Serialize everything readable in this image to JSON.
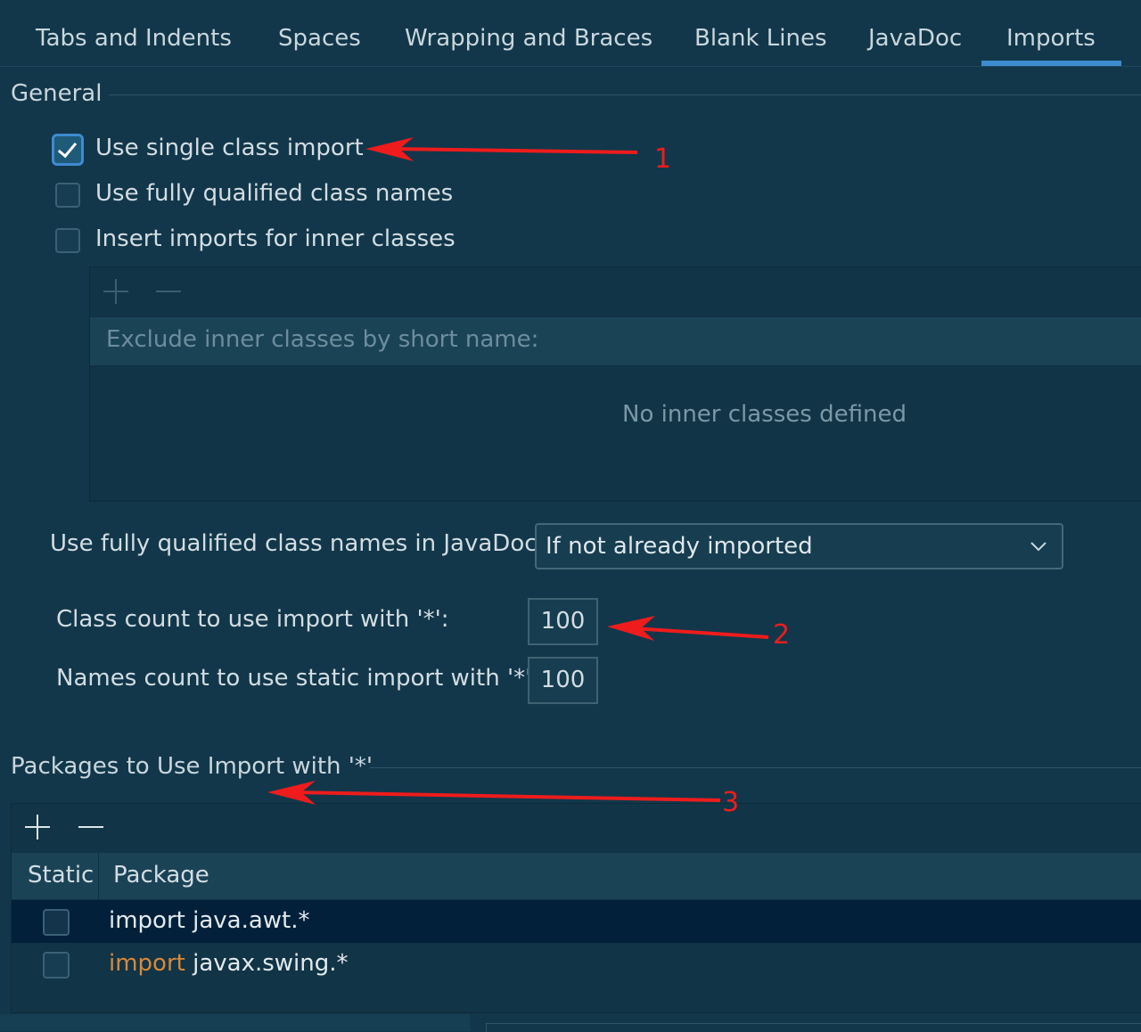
{
  "tabs": [
    {
      "label": "Tabs and Indents"
    },
    {
      "label": "Spaces"
    },
    {
      "label": "Wrapping and Braces"
    },
    {
      "label": "Blank Lines"
    },
    {
      "label": "JavaDoc"
    },
    {
      "label": "Imports",
      "selected": true
    }
  ],
  "general": {
    "title": "General",
    "options": [
      {
        "label": "Use single class import",
        "checked": true
      },
      {
        "label": "Use fully qualified class names",
        "checked": false
      },
      {
        "label": "Insert imports for inner classes",
        "checked": false
      }
    ],
    "inner_classes": {
      "add_icon": "plus-icon",
      "remove_icon": "minus-icon",
      "header": "Exclude inner classes by short name:",
      "empty_text": "No inner classes defined"
    },
    "javadoc_label": "Use fully qualified class names in JavaDoc:",
    "javadoc_value": "If not already imported",
    "class_count_label": "Class count to use import with '*':",
    "class_count_value": "100",
    "names_count_label": "Names count to use static import with '*':",
    "names_count_value": "100"
  },
  "packages": {
    "title": "Packages to Use Import with '*'",
    "columns": [
      "Static",
      "Package"
    ],
    "rows": [
      {
        "static": false,
        "keyword": "import",
        "package": " java.awt.*",
        "selected": true
      },
      {
        "static": false,
        "keyword": "import",
        "package": " javax.swing.*",
        "selected": false
      }
    ]
  },
  "annotations": {
    "a1": "1",
    "a2": "2",
    "a3": "3"
  },
  "colors": {
    "accent": "#3e8bd0",
    "background": "#12374a",
    "annotation": "#ee1c1c",
    "keyword": "#d8883a"
  }
}
